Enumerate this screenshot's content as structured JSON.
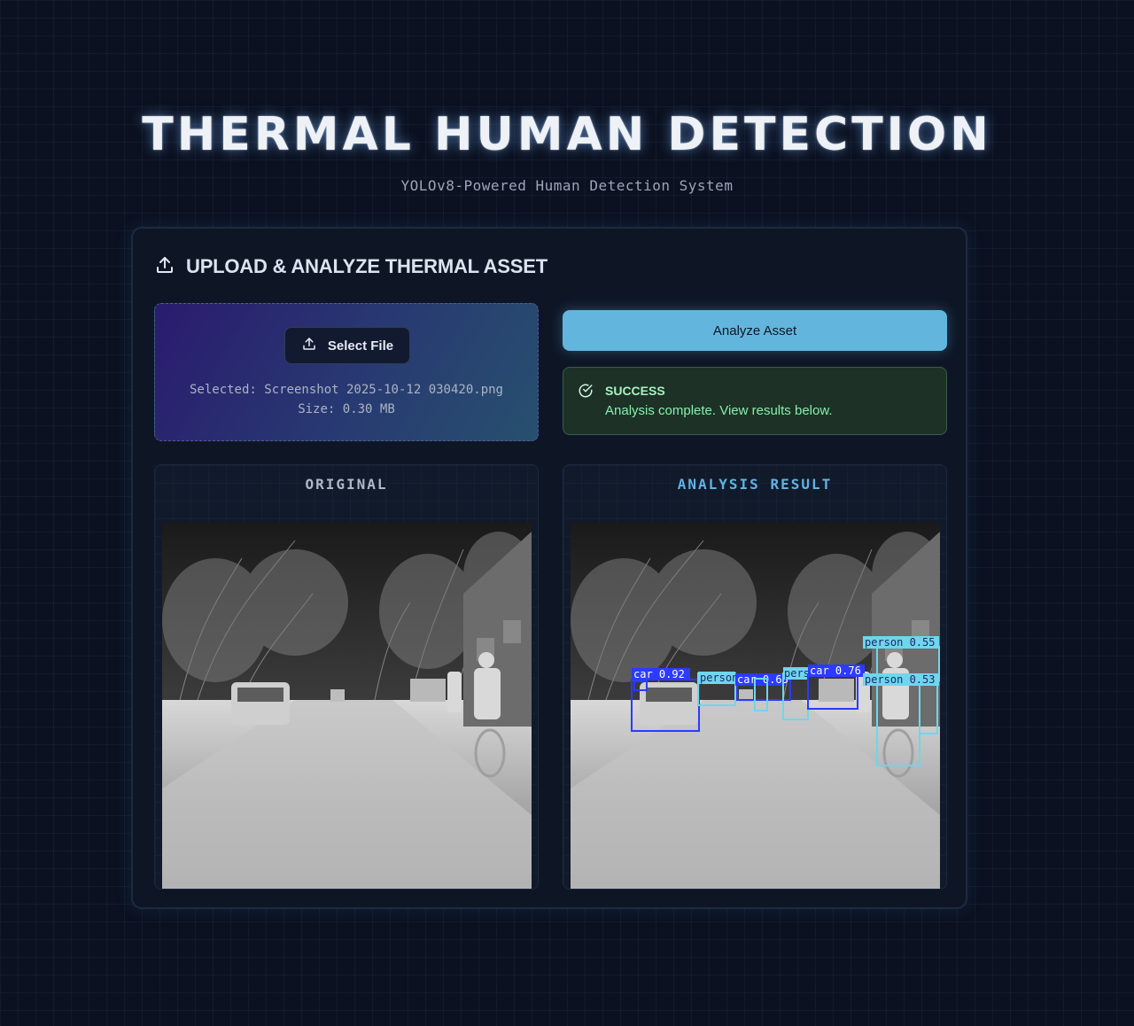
{
  "header": {
    "title": "THERMAL HUMAN DETECTION",
    "subtitle": "YOLOv8-Powered Human Detection System"
  },
  "upload_panel": {
    "title": "UPLOAD & ANALYZE THERMAL ASSET",
    "select_button": "Select File",
    "selected_file": "Selected: Screenshot 2025-10-12 030420.png",
    "file_size": "Size: 0.30 MB",
    "analyze_button": "Analyze Asset"
  },
  "status": {
    "title": "SUCCESS",
    "message": "Analysis complete. View results below."
  },
  "results": {
    "original_label": "ORIGINAL",
    "result_label": "ANALYSIS RESULT",
    "detections": [
      {
        "class": "car",
        "confidence": "0.92",
        "label": "car 0.92"
      },
      {
        "class": "person",
        "label": "person"
      },
      {
        "class": "car",
        "confidence": "0.65",
        "label": "car 0.65"
      },
      {
        "class": "person",
        "label": "pers"
      },
      {
        "class": "car",
        "confidence": "0.76",
        "label": "car 0.76"
      },
      {
        "class": "person",
        "confidence": "0.55",
        "label": "person 0.55"
      },
      {
        "class": "person",
        "confidence": "0.53",
        "label": "person 0.53"
      }
    ]
  },
  "colors": {
    "background": "#0b1120",
    "accent": "#62b6de",
    "result_label": "#5fb4e6",
    "success_bg": "#1d3127",
    "success_text": "#86efac",
    "car_box": "#2b3bff",
    "person_box": "#6fd6ec"
  },
  "icons": {
    "panel": "upload-icon",
    "select": "upload-icon",
    "status": "check-circle-icon"
  }
}
